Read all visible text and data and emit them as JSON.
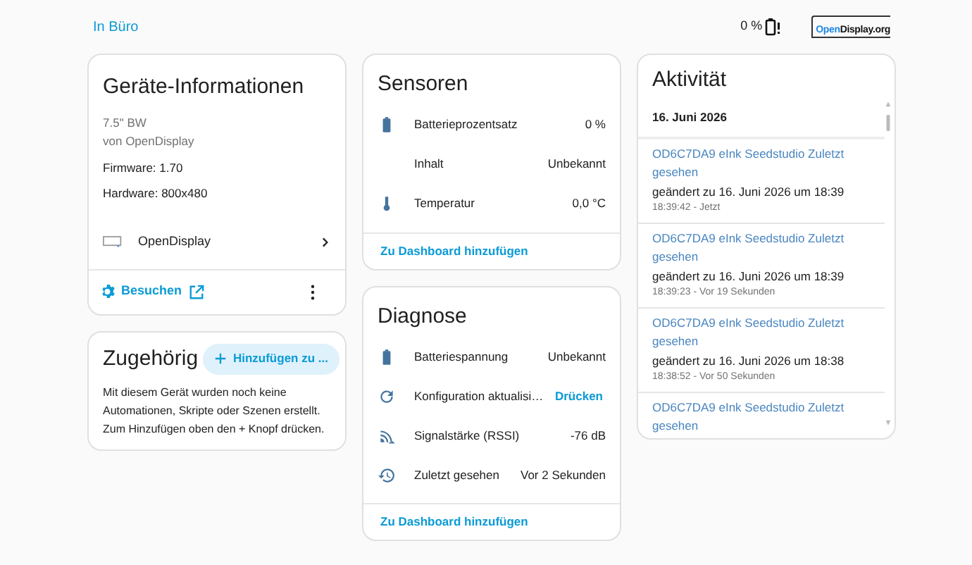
{
  "header": {
    "area": "In Büro",
    "battery": "0 %",
    "logo": [
      "Open",
      "Display.org"
    ]
  },
  "device_info": {
    "title": "Geräte-Informationen",
    "model": "7.5\" BW",
    "manufacturer": "von OpenDisplay",
    "firmware": "Firmware: 1.70",
    "hardware": "Hardware: 800x480",
    "integration": "OpenDisplay",
    "visit_button": "Besuchen"
  },
  "related": {
    "title": "Zugehörig",
    "add_button": "Hinzufügen zu ...",
    "text": "Mit diesem Gerät wurden noch keine Automationen, Skripte oder Szenen erstellt. Zum Hinzufügen oben den + Knopf drücken."
  },
  "sensors": {
    "title": "Sensoren",
    "rows": [
      {
        "kind": "battery",
        "label": "Batterieprozentsatz",
        "value": "0 %"
      },
      {
        "kind": "none",
        "label": "Inhalt",
        "value": "Unbekannt"
      },
      {
        "kind": "thermometer",
        "label": "Temperatur",
        "value": "0,0 °C"
      }
    ],
    "link": "Zu Dashboard hinzufügen"
  },
  "diagnostics": {
    "title": "Diagnose",
    "rows": [
      {
        "kind": "battery",
        "label": "Batteriespannung",
        "value": "Unbekannt"
      },
      {
        "kind": "refresh",
        "label": "Konfiguration aktualisi…",
        "button": "Drücken"
      },
      {
        "kind": "signal",
        "label": "Signalstärke (RSSI)",
        "value": "-76 dB"
      },
      {
        "kind": "history",
        "label": "Zuletzt gesehen",
        "value": "Vor 2 Sekunden"
      }
    ],
    "link": "Zu Dashboard hinzufügen"
  },
  "activity": {
    "title": "Aktivität",
    "date": "16. Juni 2026",
    "entries": [
      {
        "name": "OD6C7DA9 eInk Seedstudio Zuletzt gesehen",
        "change": "geändert zu 16. Juni 2026 um 18:39",
        "time": "18:39:42 - Jetzt"
      },
      {
        "name": "OD6C7DA9 eInk Seedstudio Zuletzt gesehen",
        "change": "geändert zu 16. Juni 2026 um 18:39",
        "time": "18:39:23 - Vor 19 Sekunden"
      },
      {
        "name": "OD6C7DA9 eInk Seedstudio Zuletzt gesehen",
        "change": "geändert zu 16. Juni 2026 um 18:38",
        "time": "18:38:52 - Vor 50 Sekunden"
      },
      {
        "name": "OD6C7DA9 eInk Seedstudio Zuletzt gesehen"
      }
    ]
  }
}
